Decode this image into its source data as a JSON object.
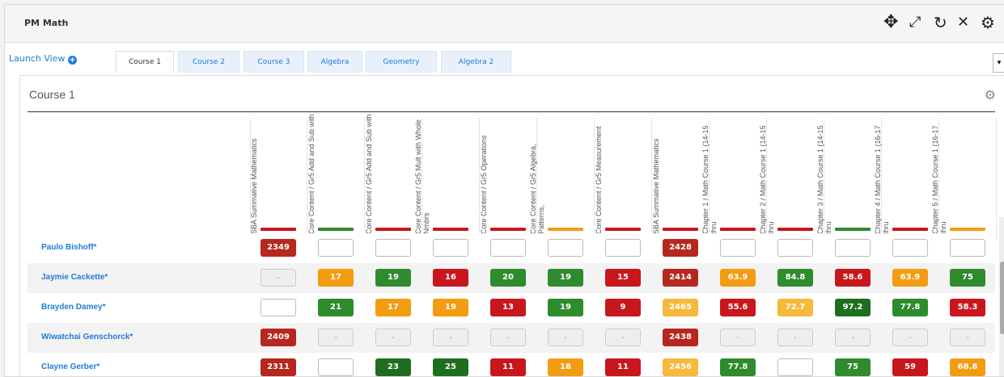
{
  "window": {
    "title": "PM Math"
  },
  "toolbar_icons": [
    "move-icon",
    "expand-icon",
    "refresh-icon",
    "close-icon",
    "settings-icon"
  ],
  "launch_view": {
    "label": "Launch View"
  },
  "tabs": [
    {
      "label": "Course 1",
      "active": true
    },
    {
      "label": "Course 2",
      "active": false
    },
    {
      "label": "Course 3",
      "active": false
    },
    {
      "label": "Algebra",
      "active": false
    },
    {
      "label": "Geometry",
      "active": false
    },
    {
      "label": "Algebra 2",
      "active": false
    }
  ],
  "panel": {
    "title": "Course 1"
  },
  "columns": [
    "SBA Summative Mathematics",
    "Core Content / Gr5 Add and Sub with",
    "Core Content / Gr5 Add and Sub with",
    "Core Content / Gr5 Mult with Whole Nmbrs",
    "Core Content / Gr5 Operations",
    "Core Content / Gr5 Algebra, Patterns,",
    "Core Content / Gr5 Measurement",
    "SBA Summative Mathematics",
    "Chapter 1 / Math Course 1 (14-15 thru",
    "Chapter 2 / Math Course 1 (14-15 thru",
    "Chapter 3 / Math Course 1 (14-15 thru",
    "Chapter 4 / Math Course 1 (16-17 thru",
    "Chapter 5 / Math Course 1 (16-17 thru"
  ],
  "colors": {
    "red": "#c8161d",
    "darkred": "#b5271f",
    "orange": "#f39c12",
    "green": "#2e8b2e",
    "darkgreen": "#1f6e1f",
    "lightorange": "#f6b93b"
  },
  "peek_colors": [
    "#c8161d",
    "#2e8b2e",
    "#c8161d",
    "#c8161d",
    "#c8161d",
    "#f39c12",
    "#c8161d",
    "#c8161d",
    "#c8161d",
    "#c8161d",
    "#2e8b2e",
    "#c8161d",
    "#f39c12"
  ],
  "rows": [
    {
      "name": "Paulo Bishoff*",
      "cells": [
        {
          "v": "2349",
          "c": "darkred"
        },
        {
          "v": "",
          "c": "blank"
        },
        {
          "v": "",
          "c": "blank"
        },
        {
          "v": "",
          "c": "blank"
        },
        {
          "v": "",
          "c": "blank"
        },
        {
          "v": "",
          "c": "blank"
        },
        {
          "v": "",
          "c": "blank"
        },
        {
          "v": "2428",
          "c": "darkred"
        },
        {
          "v": "",
          "c": "blank"
        },
        {
          "v": "",
          "c": "blank"
        },
        {
          "v": "",
          "c": "blank"
        },
        {
          "v": "",
          "c": "blank"
        },
        {
          "v": "",
          "c": "blank"
        }
      ]
    },
    {
      "name": "Jaymie Cackette*",
      "cells": [
        {
          "v": "-",
          "c": "dash"
        },
        {
          "v": "17",
          "c": "orange"
        },
        {
          "v": "19",
          "c": "green"
        },
        {
          "v": "16",
          "c": "red"
        },
        {
          "v": "20",
          "c": "green"
        },
        {
          "v": "19",
          "c": "green"
        },
        {
          "v": "15",
          "c": "red"
        },
        {
          "v": "2414",
          "c": "darkred"
        },
        {
          "v": "63.9",
          "c": "orange"
        },
        {
          "v": "84.8",
          "c": "green"
        },
        {
          "v": "58.6",
          "c": "red"
        },
        {
          "v": "63.9",
          "c": "orange"
        },
        {
          "v": "75",
          "c": "green"
        }
      ]
    },
    {
      "name": "Brayden Damey*",
      "cells": [
        {
          "v": "",
          "c": "blank"
        },
        {
          "v": "21",
          "c": "green"
        },
        {
          "v": "17",
          "c": "orange"
        },
        {
          "v": "19",
          "c": "orange"
        },
        {
          "v": "13",
          "c": "red"
        },
        {
          "v": "19",
          "c": "green"
        },
        {
          "v": "9",
          "c": "red"
        },
        {
          "v": "2465",
          "c": "lightorange"
        },
        {
          "v": "55.6",
          "c": "red"
        },
        {
          "v": "72.7",
          "c": "lightorange"
        },
        {
          "v": "97.2",
          "c": "darkgreen"
        },
        {
          "v": "77.8",
          "c": "green"
        },
        {
          "v": "58.3",
          "c": "red"
        }
      ]
    },
    {
      "name": "Wiwatchai Genschorck*",
      "cells": [
        {
          "v": "2409",
          "c": "darkred"
        },
        {
          "v": "-",
          "c": "dash"
        },
        {
          "v": "-",
          "c": "dash"
        },
        {
          "v": "-",
          "c": "dash"
        },
        {
          "v": "-",
          "c": "dash"
        },
        {
          "v": "-",
          "c": "dash"
        },
        {
          "v": "-",
          "c": "dash"
        },
        {
          "v": "2438",
          "c": "darkred"
        },
        {
          "v": "-",
          "c": "dash"
        },
        {
          "v": "-",
          "c": "dash"
        },
        {
          "v": "-",
          "c": "dash"
        },
        {
          "v": "-",
          "c": "dash"
        },
        {
          "v": "-",
          "c": "dash"
        }
      ]
    },
    {
      "name": "Clayne Gerber*",
      "cells": [
        {
          "v": "2311",
          "c": "darkred"
        },
        {
          "v": "",
          "c": "blank"
        },
        {
          "v": "23",
          "c": "darkgreen"
        },
        {
          "v": "25",
          "c": "darkgreen"
        },
        {
          "v": "11",
          "c": "red"
        },
        {
          "v": "18",
          "c": "orange"
        },
        {
          "v": "11",
          "c": "red"
        },
        {
          "v": "2456",
          "c": "lightorange"
        },
        {
          "v": "77.8",
          "c": "green"
        },
        {
          "v": "",
          "c": "blank"
        },
        {
          "v": "75",
          "c": "green"
        },
        {
          "v": "59",
          "c": "red"
        },
        {
          "v": "68.8",
          "c": "orange"
        }
      ]
    }
  ]
}
